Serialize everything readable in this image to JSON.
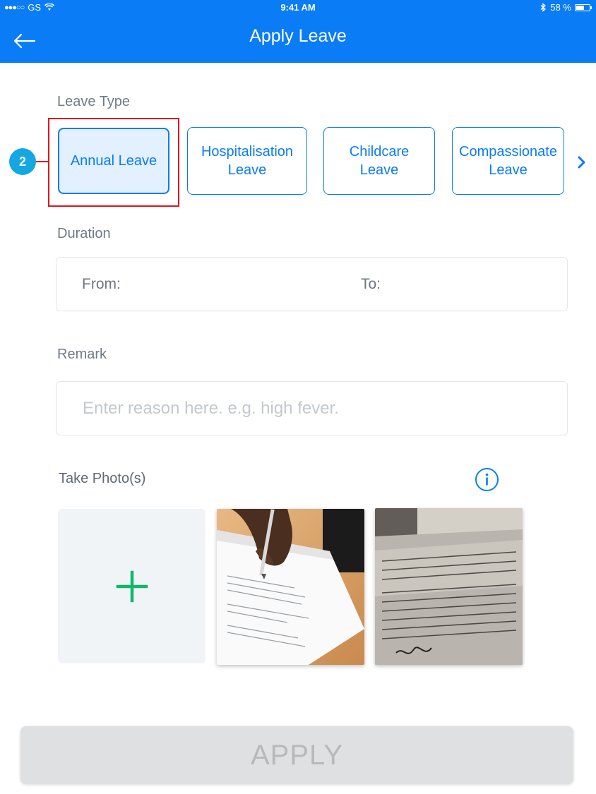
{
  "status_bar": {
    "carrier": "GS",
    "time": "9:41 AM",
    "battery": "58 %"
  },
  "header": {
    "title": "Apply Leave"
  },
  "leave_type": {
    "label": "Leave Type",
    "options": [
      {
        "line1": "Annual Leave",
        "line2": "",
        "selected": true
      },
      {
        "line1": "Hospitalisation",
        "line2": "Leave",
        "selected": false
      },
      {
        "line1": "Childcare",
        "line2": "Leave",
        "selected": false
      },
      {
        "line1": "Compassionate",
        "line2": "Leave",
        "selected": false
      }
    ],
    "annotation_number": "2"
  },
  "duration": {
    "label": "Duration",
    "from_label": "From:",
    "to_label": "To:"
  },
  "remark": {
    "label": "Remark",
    "placeholder": "Enter reason here. e.g. high fever.",
    "value": ""
  },
  "photos": {
    "label": "Take Photo(s)"
  },
  "apply_button": {
    "label": "APPLY"
  },
  "colors": {
    "primary": "#0a7cf5",
    "highlight": "#e0141e",
    "marker": "#15a7e0",
    "add_plus": "#12b76a",
    "disabled_button": "#dfe0e2"
  }
}
